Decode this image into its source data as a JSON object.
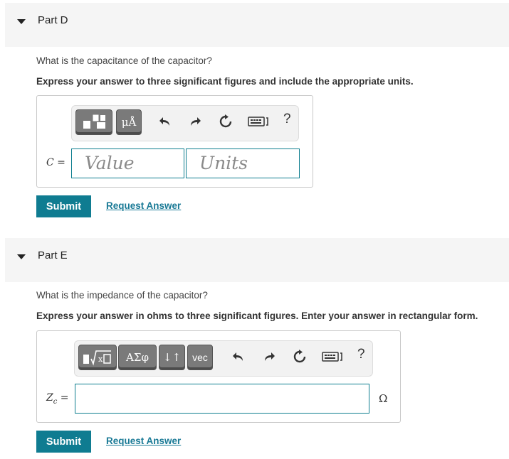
{
  "part_d": {
    "title": "Part D",
    "question": "What is the capacitance of the capacitor?",
    "instructions": "Express your answer to three significant figures and include the appropriate units.",
    "toolbar": {
      "units_button": "μÅ",
      "help": "?"
    },
    "variable": "C",
    "equals": "=",
    "value_placeholder": "Value",
    "units_placeholder": "Units",
    "submit": "Submit",
    "request_answer": "Request Answer"
  },
  "part_e": {
    "title": "Part E",
    "question": "What is the impedance of the capacitor?",
    "instructions": "Express your answer in ohms to three significant figures. Enter your answer in rectangular form.",
    "toolbar": {
      "greek_button": "ΑΣφ",
      "arrows_button": "↓↑",
      "vec_button": "vec",
      "help": "?"
    },
    "variable": "Z",
    "variable_sub": "c",
    "equals": "=",
    "unit": "Ω",
    "submit": "Submit",
    "request_answer": "Request Answer"
  },
  "colors": {
    "accent": "#0f7c91",
    "link": "#1a7a96",
    "header_bg": "#f5f5f5"
  }
}
